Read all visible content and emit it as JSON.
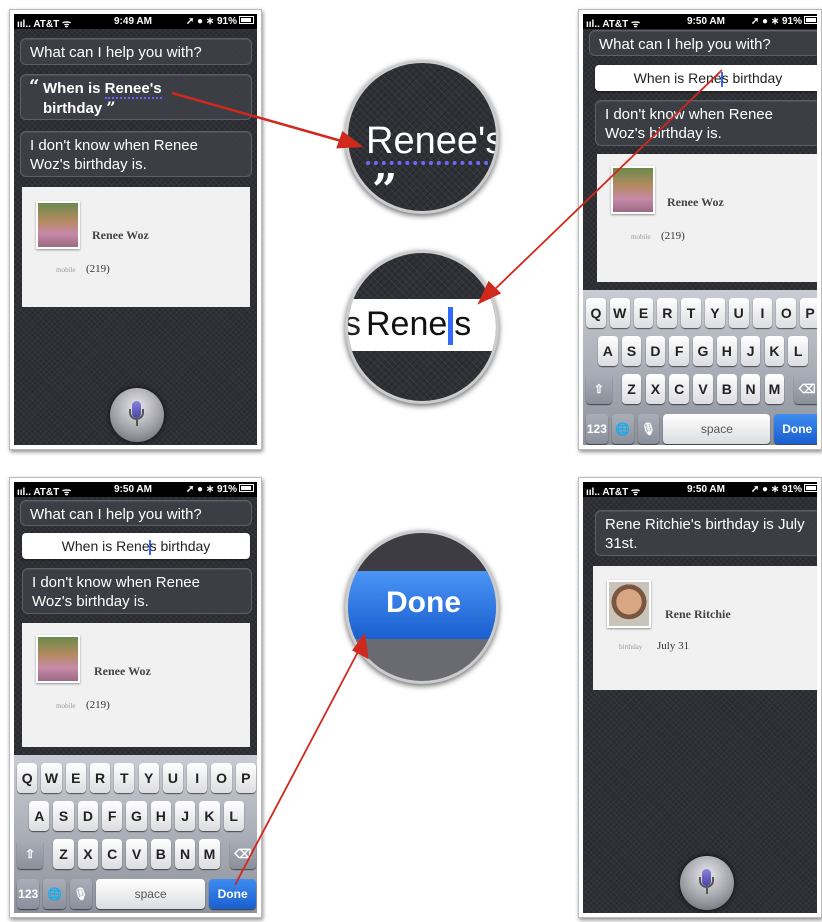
{
  "status": {
    "carrier": "AT&T",
    "battery": "91%",
    "time_1": "9:49 AM",
    "time_2": "9:50 AM",
    "time_3": "9:50 AM",
    "time_4": "9:50 AM"
  },
  "siri": {
    "prompt": "What can I help you with?",
    "query_open": "“",
    "query_line1_a": "When is ",
    "query_line1_b": "Renee's",
    "query_line2": "birthday",
    "query_close": "”",
    "edit_before": "When is Rene",
    "edit_after": "s birthday",
    "response_line1": "I don't know when Renee",
    "response_line2": "Woz's birthday is.",
    "final_line1": "Rene Ritchie's birthday is July",
    "final_line2": "31st."
  },
  "contact1": {
    "name": "Renee Woz",
    "label": "mobile",
    "value": "(219)"
  },
  "contact2": {
    "name": "Rene Ritchie",
    "label": "birthday",
    "value": "July 31"
  },
  "keyboard": {
    "row1": [
      "Q",
      "W",
      "E",
      "R",
      "T",
      "Y",
      "U",
      "I",
      "O",
      "P"
    ],
    "row2": [
      "A",
      "S",
      "D",
      "F",
      "G",
      "H",
      "J",
      "K",
      "L"
    ],
    "row3": [
      "Z",
      "X",
      "C",
      "V",
      "B",
      "N",
      "M"
    ],
    "shift": "⇧",
    "backspace": "⌫",
    "numbers": "123",
    "globe": "🌐",
    "mic": "🎙",
    "space": "space",
    "done": "Done"
  },
  "lenses": {
    "renee": "Renee's",
    "quote": "”",
    "rene_a": "Rene",
    "rene_b": "s",
    "rene_pre": "s",
    "done": "Done"
  },
  "colors": {
    "accent_blue": "#1a5fd0",
    "arrow_red": "#d0281c",
    "caret": "#3469ff"
  }
}
